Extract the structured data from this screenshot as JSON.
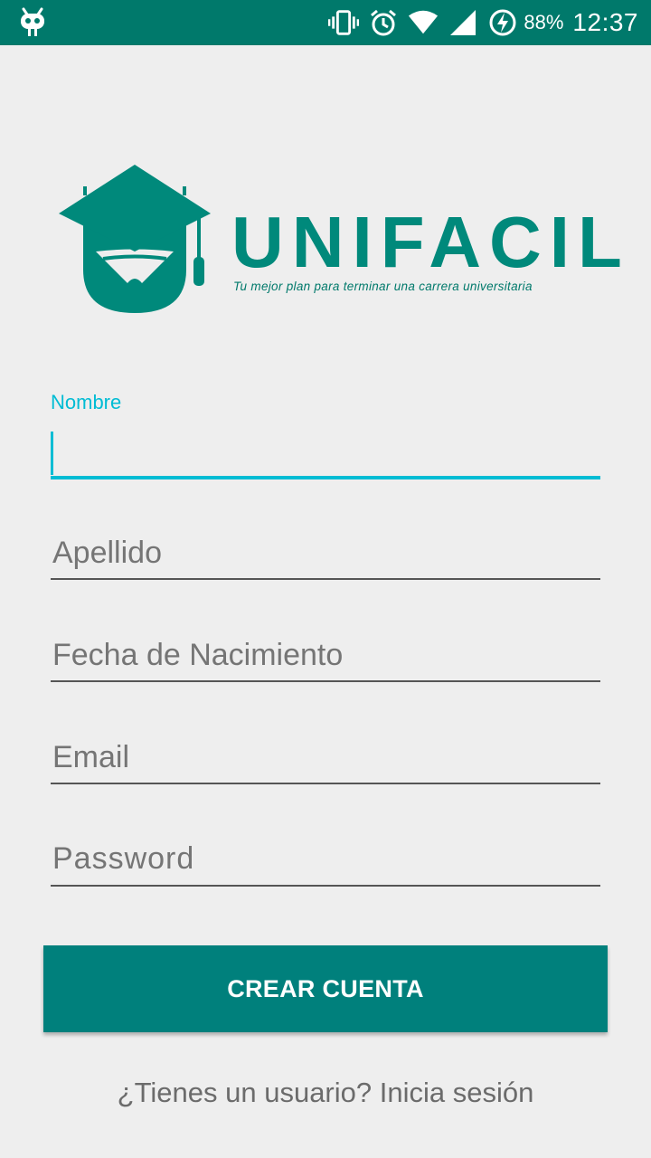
{
  "status_bar": {
    "battery_percent": "88%",
    "time": "12:37",
    "icons": [
      "cyanogen-bug-icon",
      "vibrate-icon",
      "alarm-icon",
      "wifi-icon",
      "cell-signal-icon",
      "battery-charging-icon"
    ]
  },
  "logo": {
    "brand": "UNIFACIL",
    "tagline": "Tu mejor plan para terminar una carrera universitaria",
    "color": "#00897b"
  },
  "form": {
    "nombre": {
      "label": "Nombre",
      "value": ""
    },
    "apellido": {
      "placeholder": "Apellido"
    },
    "fecha": {
      "placeholder": "Fecha de Nacimiento"
    },
    "email": {
      "placeholder": "Email"
    },
    "password": {
      "placeholder": "Password"
    }
  },
  "actions": {
    "create_account": "CREAR CUENTA",
    "signin_prompt": "¿Tienes un usuario? Inicia sesión"
  },
  "colors": {
    "status_bar": "#00796b",
    "accent": "#00bcd4",
    "button": "#00807c",
    "background": "#eeeeee"
  }
}
